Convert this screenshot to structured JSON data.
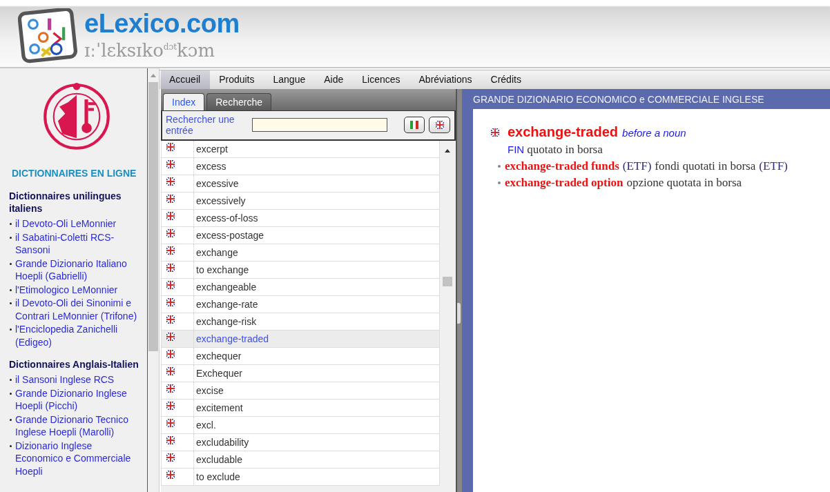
{
  "header": {
    "site_name": "eLexico.com",
    "phonetic": "ɪːˈlɛksɪko",
    "phonetic_small": "dɔt",
    "phonetic_end": "kɔm"
  },
  "sidebar": {
    "heading": "DICTIONNAIRES EN LIGNE",
    "sections": [
      {
        "title": "Dictionnaires unilingues italiens",
        "links": [
          "il Devoto-Oli LeMonnier",
          "il Sabatini-Coletti RCS-Sansoni",
          "Grande Dizionario Italiano Hoepli (Gabrielli)",
          "l'Etimologico LeMonnier",
          "il Devoto-Oli dei Sinonimi e Contrari LeMonnier (Trifone)",
          "l'Enciclopedia Zanichelli (Edigeo)"
        ]
      },
      {
        "title": "Dictionnaires Anglais-Italien",
        "links": [
          "il Sansoni Inglese RCS",
          "Grande Dizionario Inglese Hoepli (Picchi)",
          "Grande Dizionario Tecnico Inglese Hoepli (Marolli)",
          "Dizionario Inglese Economico e Commerciale Hoepli"
        ]
      }
    ]
  },
  "menu": [
    {
      "label": "Accueil",
      "selected": true
    },
    {
      "label": "Produits",
      "selected": false
    },
    {
      "label": "Langue",
      "selected": false
    },
    {
      "label": "Aide",
      "selected": false
    },
    {
      "label": "Licences",
      "selected": false
    },
    {
      "label": "Abréviations",
      "selected": false
    },
    {
      "label": "Crédits",
      "selected": false
    }
  ],
  "index_tabs": [
    {
      "label": "Index",
      "selected": true
    },
    {
      "label": "Recherche",
      "selected": false
    }
  ],
  "search": {
    "label": "Rechercher une entrée"
  },
  "index": [
    {
      "word": "excerpt",
      "selected": false
    },
    {
      "word": "excess",
      "selected": false
    },
    {
      "word": "excessive",
      "selected": false
    },
    {
      "word": "excessively",
      "selected": false
    },
    {
      "word": "excess-of-loss",
      "selected": false
    },
    {
      "word": "excess-postage",
      "selected": false
    },
    {
      "word": "exchange",
      "selected": false
    },
    {
      "word": "to exchange",
      "selected": false
    },
    {
      "word": "exchangeable",
      "selected": false
    },
    {
      "word": "exchange-rate",
      "selected": false
    },
    {
      "word": "exchange-risk",
      "selected": false
    },
    {
      "word": "exchange-traded",
      "selected": true
    },
    {
      "word": "exchequer",
      "selected": false
    },
    {
      "word": "Exchequer",
      "selected": false
    },
    {
      "word": "excise",
      "selected": false
    },
    {
      "word": "excitement",
      "selected": false
    },
    {
      "word": "excl.",
      "selected": false
    },
    {
      "word": "excludability",
      "selected": false
    },
    {
      "word": "excludable",
      "selected": false
    },
    {
      "word": "to exclude",
      "selected": false
    }
  ],
  "entry": {
    "dictionary_title": "GRANDE DIZIONARIO ECONOMICO e COMMERCIALE INGLESE",
    "headword": "exchange-traded",
    "grammar": "before a noun",
    "field": "FIN",
    "translation": "quotato in borsa",
    "phrases": [
      [
        {
          "kind": "phrase",
          "text": "exchange-traded funds"
        },
        {
          "kind": "abbr",
          "text": "(ETF)"
        },
        {
          "kind": "plain",
          "text": "fondi quotati in borsa"
        },
        {
          "kind": "abbr",
          "text": "(ETF)"
        }
      ],
      [
        {
          "kind": "phrase",
          "text": "exchange-traded option"
        },
        {
          "kind": "plain",
          "text": "opzione quotata in borsa"
        }
      ]
    ]
  }
}
